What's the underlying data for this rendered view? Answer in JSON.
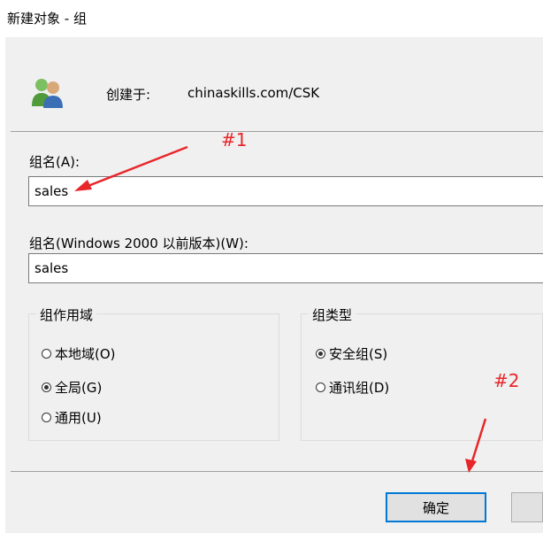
{
  "window": {
    "title": "新建对象 - 组"
  },
  "created_in": {
    "label": "创建于:",
    "value": "chinaskills.com/CSK"
  },
  "group_name": {
    "label": "组名(A):",
    "value": "sales"
  },
  "group_name_legacy": {
    "label": "组名(Windows 2000 以前版本)(W):",
    "value": "sales"
  },
  "group_scope": {
    "title": "组作用域",
    "options": [
      "本地域(O)",
      "全局(G)",
      "通用(U)"
    ],
    "selected": "全局(G)"
  },
  "group_type": {
    "title": "组类型",
    "options": [
      "安全组(S)",
      "通讯组(D)"
    ],
    "selected": "安全组(S)"
  },
  "buttons": {
    "ok": "确定",
    "cancel": ""
  },
  "annotations": {
    "one": "#1",
    "two": "#2",
    "color": "#e8262a"
  },
  "icons": {
    "group": "group-icon"
  }
}
